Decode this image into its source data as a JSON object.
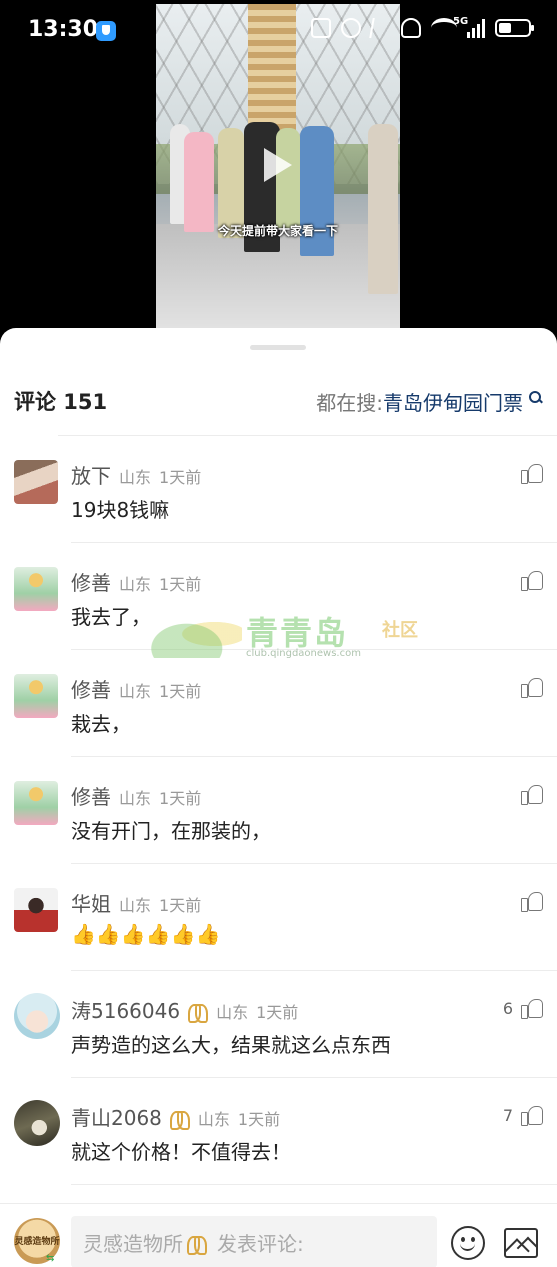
{
  "status_bar": {
    "time": "13:30",
    "network": "5G",
    "icons": [
      "shield-icon",
      "nfc-icon",
      "mute-icon",
      "bluetooth-off-icon",
      "alarm-off-icon",
      "wifi-icon",
      "signal-icon",
      "battery-icon"
    ]
  },
  "video": {
    "caption": "今天提前带大家看一下",
    "play_icon": "play-icon"
  },
  "header": {
    "comment_count_label": "评论 151",
    "trending_label": "都在搜:",
    "trending_query": "青岛伊甸园门票"
  },
  "comments": [
    {
      "user": "放下",
      "location": "山东",
      "time": "1天前",
      "text": "19块8钱嘛",
      "likes": ""
    },
    {
      "user": "修善",
      "location": "山东",
      "time": "1天前",
      "text": "我去了，",
      "likes": ""
    },
    {
      "user": "修善",
      "location": "山东",
      "time": "1天前",
      "text": "栽去，",
      "likes": ""
    },
    {
      "user": "修善",
      "location": "山东",
      "time": "1天前",
      "text": "没有开门，在那装的，",
      "likes": ""
    },
    {
      "user": "华姐",
      "location": "山东",
      "time": "1天前",
      "text": "👍👍👍👍👍👍",
      "likes": ""
    },
    {
      "user": "涛5166046",
      "location": "山东",
      "time": "1天前",
      "text": "声势造的这么大，结果就这么点东西",
      "likes": "6"
    },
    {
      "user": "青山2068",
      "location": "山东",
      "time": "1天前",
      "text": "就这个价格！不值得去！",
      "likes": "7"
    }
  ],
  "watermark": {
    "title": "青青岛",
    "subtitle": "社区",
    "url": "club.qingdaonews.com"
  },
  "bottom_bar": {
    "my_avatar_text": "灵感造物所",
    "input_user": "灵感造物所",
    "input_placeholder": "发表评论:"
  },
  "colors": {
    "accent_query": "#163a6b",
    "badge_gold": "#d9a640"
  }
}
